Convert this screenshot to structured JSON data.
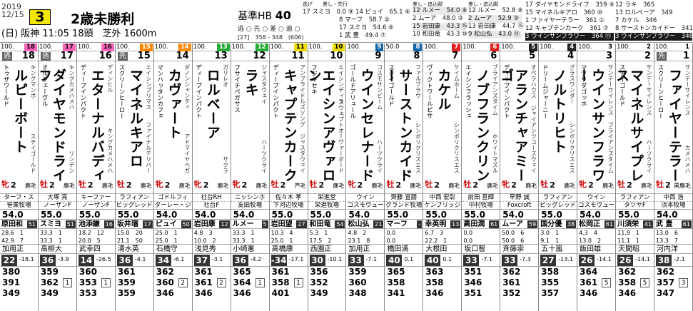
{
  "header": {
    "date": "2019\n12/15",
    "race_number": "3",
    "race_name": "2歳未勝利",
    "sub": "(日) 阪神 11:05 18頭　芝外 1600m",
    "handicap_label": "基準HB",
    "handicap_value": "40",
    "positions": "逃 ○ 先 ○ 差 ○ 追 ○",
    "distance_info": "[27]　358 - 348　(606)"
  },
  "tables": {
    "t1_title": "逃げ　　差し・先行",
    "t1_rows": [
      "17 スミヨ　0.0 ⑨ 14 ピュイ　65.1 ⑥",
      "　　　　　　8 マーフ　58.7 ②",
      "　　　　　　17 スミヨ　54.6 ⑥",
      "　　　　　　1 武 豊　49.4 ⑦"
    ],
    "t2_title": "差し・追込脚",
    "t2_rows": [
      "12 ルメー　54.0 ⑧",
      "2 ムーア　48.0 ③",
      "15 岩田康　43.3 ⑮",
      "10 和田竜　43.3 ⑩"
    ],
    "t3_title": "差し・追込脚",
    "t3_rows": [
      "12 ルメー　52.8 ⑧",
      "2 ムーア　52.9 ③",
      "13 岩田康　44.7 ⑮",
      "9 松山弘　43.0 ⑪"
    ],
    "t4_rows": [
      "17 ダイヤモンドライフ　359 ⑨",
      "15 マイネルキアロ　360 ⑩",
      "1 ファイヤーテラー　361 ①",
      "12 キャプテンカーク　361 ⑦",
      "3 ウインサンフラワー　364 ⑪"
    ],
    "t5_rows": [
      "12 ラキ　365",
      "13 ロルベーア　349",
      "7 カケル　346",
      "8 サーストンカイドー　341",
      "3 ウインサンフラワー　346"
    ]
  },
  "horses": [
    {
      "weight_top": "100.",
      "waku_mark": "逃",
      "num": "18",
      "sire": "トゥザワールド",
      "name": "ルピーボート",
      "dam": "キングマンボ",
      "dam_sire": "ステイゴールド",
      "sex": "牝",
      "age": "2",
      "coat": "鹿毛",
      "trainer_top": "ターフ・ス",
      "owner": "笹栗牧場",
      "kg": "54.0",
      "jockey": "原田和",
      "rank": "51",
      "stat1": "28.6　1",
      "stat2": "42.9　7",
      "region": "加用正",
      "od": "22",
      "os": "-18.1",
      "hist": [
        "380",
        "391",
        "349"
      ],
      "box": ""
    },
    {
      "weight_top": "100.",
      "waku_mark": "逃",
      "num": "17",
      "sire": "オルフェーヴル",
      "name": "ダイヤモンドライフ",
      "dam": "キングカメハメハ",
      "dam_sire": "リンデン",
      "sex": "牡",
      "age": "2",
      "coat": "鹿毛",
      "trainer_top": "大塚 亮",
      "owner": "ノーザンF",
      "kg": "55.0",
      "jockey": "スミヨ",
      "rank": "51",
      "stat1": "33.3　1",
      "stat2": "33.3　1",
      "region": "高柳大",
      "od": "36",
      "os": "-3.9",
      "hist": [
        "359",
        "362",
        "349"
      ],
      "box": "1"
    },
    {
      "weight_top": "100.",
      "waku_mark": "",
      "num": "16",
      "sire": "ディープインパクト",
      "name": "エターナルバディ",
      "dam": "ディンヒル",
      "dam_sire": "キングカメハメハ",
      "sex": "牡",
      "age": "2",
      "coat": "鹿毛",
      "trainer_top": "キーファー",
      "owner": "ノーザンF",
      "kg": "55.0",
      "jockey": "池添謙",
      "rank": "16",
      "stat1": "18.2　12",
      "stat2": "20.0　5",
      "region": "武幸四",
      "od": "14",
      "os": "-26.5",
      "hist": [
        "360",
        "353",
        "353"
      ],
      "box": "1"
    },
    {
      "weight_top": "100.",
      "waku_mark": "先",
      "num": "15",
      "sire": "スクリーンヒーロー",
      "name": "マイネルキアロ",
      "dam": "エイシンプリマス",
      "dam_sire": "ファイナルデリバー",
      "sex": "牡",
      "age": "2",
      "coat": "鹿毛",
      "trainer_top": "ラフィアン",
      "owner": "ビッグレッド",
      "kg": "55.0",
      "jockey": "坂井瑠",
      "rank": "17",
      "stat1": "15.0　20",
      "stat2": "21.1　50",
      "region": "清水英",
      "od": "36",
      "os": "-4.1",
      "hist": [
        "361",
        "359",
        "359"
      ],
      "box": ""
    },
    {
      "weight_top": "100.",
      "waku_mark": "",
      "num": "14",
      "sire": "マンハッタンカフェ",
      "name": "カヴァート",
      "dam": "ダノンシャンティ",
      "dam_sire": "アドマイヤベガ",
      "sex": "牝",
      "age": "2",
      "coat": "鹿毛",
      "trainer_top": "ゴドルフィ",
      "owner": "ダーレー・ジ",
      "kg": "54.0",
      "jockey": "ピュイ",
      "rank": "50",
      "stat1": "25.0　1",
      "stat2": "25.0　1",
      "region": "石橋守",
      "od": "34",
      "os": "-6.1",
      "hist": [
        "362",
        "360",
        "346"
      ],
      "box": "2"
    },
    {
      "weight_top": "100.",
      "waku_mark": "",
      "num": "13",
      "sire": "ディープインパクト",
      "name": "ロルベーア",
      "dam": "ガリレオ",
      "dam_sire": "サクラ",
      "sex": "牝",
      "age": "2",
      "coat": "鹿毛",
      "trainer_top": "社台RH",
      "owner": "社台F",
      "kg": "54.0",
      "jockey": "岩田康",
      "rank": "12",
      "stat1": "4.8　3",
      "stat2": "10.0　2",
      "region": "浅見秀",
      "od": "37",
      "os": "-3.1",
      "hist": [
        "361",
        "361",
        "346"
      ],
      "box": "2"
    },
    {
      "weight_top": "100.",
      "waku_mark": "",
      "num": "12",
      "sire": "フサイチペガサス",
      "name": "ラキ",
      "dam": "ジャスタウェイ",
      "dam_sire": "ハーツクライ",
      "sex": "牝",
      "age": "2",
      "coat": "鹿毛",
      "trainer_top": "ニッシンホ",
      "owner": "友田牧場",
      "kg": "54.0",
      "jockey": "ルメー",
      "rank": "5",
      "stat1": "33.3　1",
      "stat2": "33.3　1",
      "region": "小崎憲",
      "od": "36",
      "os": "-4.2",
      "hist": [
        "365",
        "364",
        "346"
      ],
      "box": "1"
    },
    {
      "weight_top": "100.",
      "waku_mark": "",
      "num": "11",
      "sire": "ディープインパクト",
      "name": "キャプテンカーク",
      "dam": "アンブライドルズソング",
      "dam_sire": "ジャスタウェイ",
      "sex": "牡",
      "age": "2",
      "coat": "芦毛",
      "trainer_top": "佐々木 孝",
      "owner": "下河辺牧場",
      "kg": "55.0",
      "jockey": "岩田望",
      "rank": "27",
      "stat1": "10.3　4",
      "stat2": "25.0　1",
      "region": "高橋康",
      "od": "-34",
      "os": "-17.1",
      "hist": [
        "361",
        "358",
        "401"
      ],
      "box": "1"
    },
    {
      "weight_top": "100.",
      "waku_mark": "",
      "num": "10",
      "sire": "フジキセキ",
      "name": "エイシンアヴァロン",
      "dam": "エイシンディラ",
      "dam_sire": "スウェプトオーヴァーボード",
      "sex": "牡",
      "age": "2",
      "coat": "鹿毛",
      "trainer_top": "栄進堂",
      "owner": "栄進牧場",
      "kg": "55.0",
      "jockey": "和田竜",
      "rank": "54",
      "stat1": "5.3　1",
      "stat2": "17.5　2",
      "region": "西園正",
      "od": "30",
      "os": "-10.1",
      "hist": [
        "356",
        "352",
        "349"
      ],
      "box": ""
    },
    {
      "weight_top": "100.",
      "waku_mark": "",
      "num": "9",
      "sire": "ゴールドアリュール",
      "name": "ウインセレナード",
      "dam": "コスモサンビーム",
      "dam_sire": "ハーツクライ",
      "sex": "牝",
      "age": "2",
      "coat": "鹿毛",
      "trainer_top": "ウイン",
      "owner": "コスモヴュー",
      "kg": "54.0",
      "jockey": "松山弘",
      "rank": "21",
      "stat1": "4.8　2",
      "stat2": "23.1　8",
      "region": "加用正",
      "od": "33",
      "os": "-7.1",
      "hist": [
        "359",
        "360",
        "348"
      ],
      "box": ""
    },
    {
      "weight_top": "50.0",
      "waku_mark": "",
      "num": "8",
      "sire": "ステイゴールド",
      "name": "サーストンカイドー",
      "dam": "ファルブラヴ",
      "dam_sire": "シンボリクリスエス",
      "sex": "牡",
      "age": "2",
      "coat": "鹿毛",
      "trainer_top": "齊藤 宣勝",
      "owner": "グランド牧場",
      "kg": "55.0",
      "jockey": "マーフ",
      "rank": "-",
      "stat1": "0.0",
      "stat2": "0.0",
      "region": "橋田満",
      "od": "40",
      "os": "0.1",
      "hist": [
        "365",
        "358",
        "341"
      ],
      "box": ""
    },
    {
      "weight_top": "100.",
      "waku_mark": "",
      "num": "7",
      "sire": "ヴィクトワールピサ",
      "name": "カケル",
      "dam": "ケイムホーム",
      "dam_sire": "シンボリクリスエス",
      "sex": "牡",
      "age": "2",
      "coat": "鹿毛",
      "trainer_top": "中西 宏彰",
      "owner": "ケンブリッジ",
      "kg": "55.0",
      "jockey": "幸英明",
      "rank": "13",
      "stat1": "6.7　3",
      "stat2": "22.2　1",
      "region": "大根田",
      "od": "40",
      "os": "0.1",
      "hist": [
        "363",
        "358",
        "346"
      ],
      "box": ""
    },
    {
      "weight_top": "100.",
      "waku_mark": "",
      "num": "6",
      "sire": "エイシンフラッシュ",
      "name": "ノブフランクリン",
      "dam": "ブライアンズタイム",
      "dam_sire": "ホワイトマズル",
      "sex": "牡",
      "age": "2",
      "coat": "鹿毛",
      "trainer_top": "前田 亘輝",
      "owner": "中村牧場",
      "kg": "55.0",
      "jockey": "高田潤",
      "rank": "61",
      "stat1": "0.0",
      "stat2": "0.0",
      "region": "坂口智",
      "od": "33",
      "os": "-7.1",
      "hist": [
        "351",
        "346",
        "351"
      ],
      "box": ""
    },
    {
      "weight_top": "100.",
      "waku_mark": "",
      "num": "5",
      "sire": "ディープインパクト",
      "name": "アランチャアミーゴ",
      "dam": "オペラハウス",
      "dam_sire": "ジャイアンツコーズウェイ",
      "sex": "牝",
      "age": "2",
      "coat": "鹿毛",
      "trainer_top": "早野 誠",
      "owner": "Foxcroft",
      "kg": "54.0",
      "jockey": "ムーア",
      "rank": "59",
      "stat1": "50.0　6",
      "stat2": "50.0　6",
      "region": "斉藤崇",
      "od": "33",
      "os": "-7.3",
      "hist": [
        "362",
        "361",
        "352"
      ],
      "box": ""
    },
    {
      "weight_top": "100.",
      "waku_mark": "",
      "num": "4",
      "sire": "ドリームジャーニー",
      "name": "ノルトリヒト",
      "dam": "グラスワンダー",
      "dam_sire": "シンボリクリスエス",
      "sex": "牡",
      "age": "2",
      "coat": "鹿毛",
      "trainer_top": "ラフィアン",
      "owner": "ビッグレッド",
      "kg": "55.0",
      "jockey": "国分優",
      "rank": "38",
      "stat1": "3.0　1",
      "stat2": "9.1　1",
      "region": "五十嵐",
      "od": "27",
      "os": "-13.1",
      "hist": [
        "358",
        "355",
        "357"
      ],
      "box": ""
    },
    {
      "weight_top": "100.",
      "waku_mark": "",
      "num": "3",
      "sire": "マツリダゴッホ",
      "name": "ウインサンフラワー",
      "dam": "サンデーサイレンス",
      "dam_sire": "ブライアンズタイム",
      "sex": "牝",
      "age": "2",
      "coat": "鹿毛",
      "trainer_top": "ウイン",
      "owner": "コスモヴュー",
      "kg": "54.0",
      "jockey": "松岡正",
      "rank": "61",
      "stat1": "4.3　4",
      "stat2": "13.0　2",
      "region": "飯田雄",
      "od": "26",
      "os": "-14.1",
      "hist": [
        "364",
        "361",
        "346"
      ],
      "box": "5"
    },
    {
      "weight_top": "100.",
      "waku_mark": "",
      "num": "2",
      "sire": "ステイゴールド",
      "name": "マイネルサイプレス",
      "dam": "サンデーサイレンス",
      "dam_sire": "ハーツクライ",
      "sex": "牡",
      "age": "2",
      "coat": "鹿毛",
      "trainer_top": "ラフィアン",
      "owner": "タツヤF",
      "kg": "55.0",
      "jockey": "川須栄",
      "rank": "41",
      "stat1": "11.9　1",
      "stat2": "11.1　1",
      "region": "天間昭",
      "od": "26",
      "os": "-14.1",
      "hist": [
        "362",
        "358",
        "346"
      ],
      "box": "5"
    },
    {
      "weight_top": "100.",
      "waku_mark": "先",
      "num": "1",
      "sire": "スクリーンヒーロー",
      "name": "ファイヤーテラー",
      "dam": "サンデーサイレンス",
      "dam_sire": "カメハメハ",
      "sex": "牡",
      "age": "2",
      "coat": "黒鹿毛",
      "trainer_top": "中西 浩",
      "owner": "浜本牧場",
      "kg": "54.0",
      "jockey": "武 豊",
      "rank": "61",
      "stat1": "13.0　6",
      "stat2": "13.3　7",
      "region": "河内洋",
      "od": "38",
      "os": "-2.1",
      "hist": [
        "362",
        "357",
        "347"
      ],
      "box": "3"
    }
  ],
  "waku_colors": [
    "#f6b",
    "#f6b",
    "#f6b",
    "#f80",
    "#f80",
    "#2a3",
    "#2a3",
    "#ed0",
    "#ed0",
    "#16a",
    "#16a",
    "#d22",
    "#d22",
    "#222",
    "#222",
    "#fff",
    "#fff",
    "#fff"
  ]
}
